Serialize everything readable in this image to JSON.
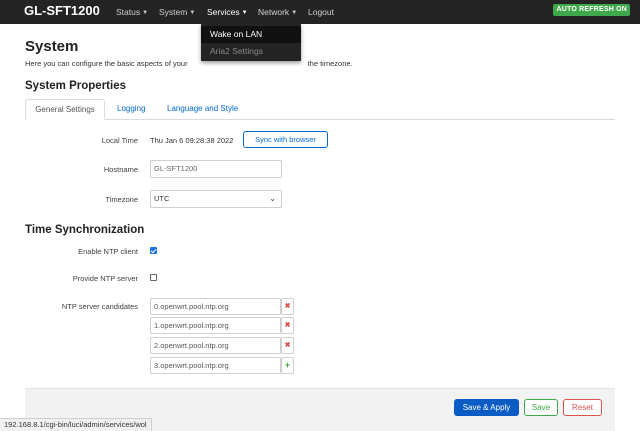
{
  "navbar": {
    "brand": "GL-SFT1200",
    "menus": [
      "Status",
      "System",
      "Services",
      "Network",
      "Logout"
    ],
    "auto_refresh": "AUTO REFRESH ON"
  },
  "dropdown": {
    "items": [
      "Wake on LAN",
      "Aria2 Settings"
    ]
  },
  "page": {
    "title": "System",
    "description_left": "Here you can configure the basic aspects of your",
    "description_right": "the timezone."
  },
  "properties": {
    "title": "System Properties",
    "tabs": [
      "General Settings",
      "Logging",
      "Language and Style"
    ],
    "local_time_label": "Local Time",
    "local_time_value": "Thu Jan 6 09:28:38 2022",
    "sync_button": "Sync with browser",
    "hostname_label": "Hostname",
    "hostname_value": "GL-SFT1200",
    "timezone_label": "Timezone",
    "timezone_value": "UTC"
  },
  "time_sync": {
    "title": "Time Synchronization",
    "enable_ntp_label": "Enable NTP client",
    "enable_ntp_checked": true,
    "provide_ntp_label": "Provide NTP server",
    "provide_ntp_checked": false,
    "candidates_label": "NTP server candidates",
    "servers": [
      "0.openwrt.pool.ntp.org",
      "1.openwrt.pool.ntp.org",
      "2.openwrt.pool.ntp.org",
      "3.openwrt.pool.ntp.org"
    ]
  },
  "actions": {
    "save_apply": "Save & Apply",
    "save": "Save",
    "reset": "Reset"
  },
  "statusbar": {
    "url": "192.168.8.1/cgi-bin/luci/admin/services/wol"
  },
  "icons": {
    "dropdown_caret": "caret-down-icon",
    "select_caret": "chevron-down-icon",
    "remove": "remove-x-icon",
    "add": "plus-icon"
  },
  "colors": {
    "accent": "#0069d6",
    "navbar": "#242424",
    "success": "#3fa84a",
    "danger": "#d9534f"
  }
}
